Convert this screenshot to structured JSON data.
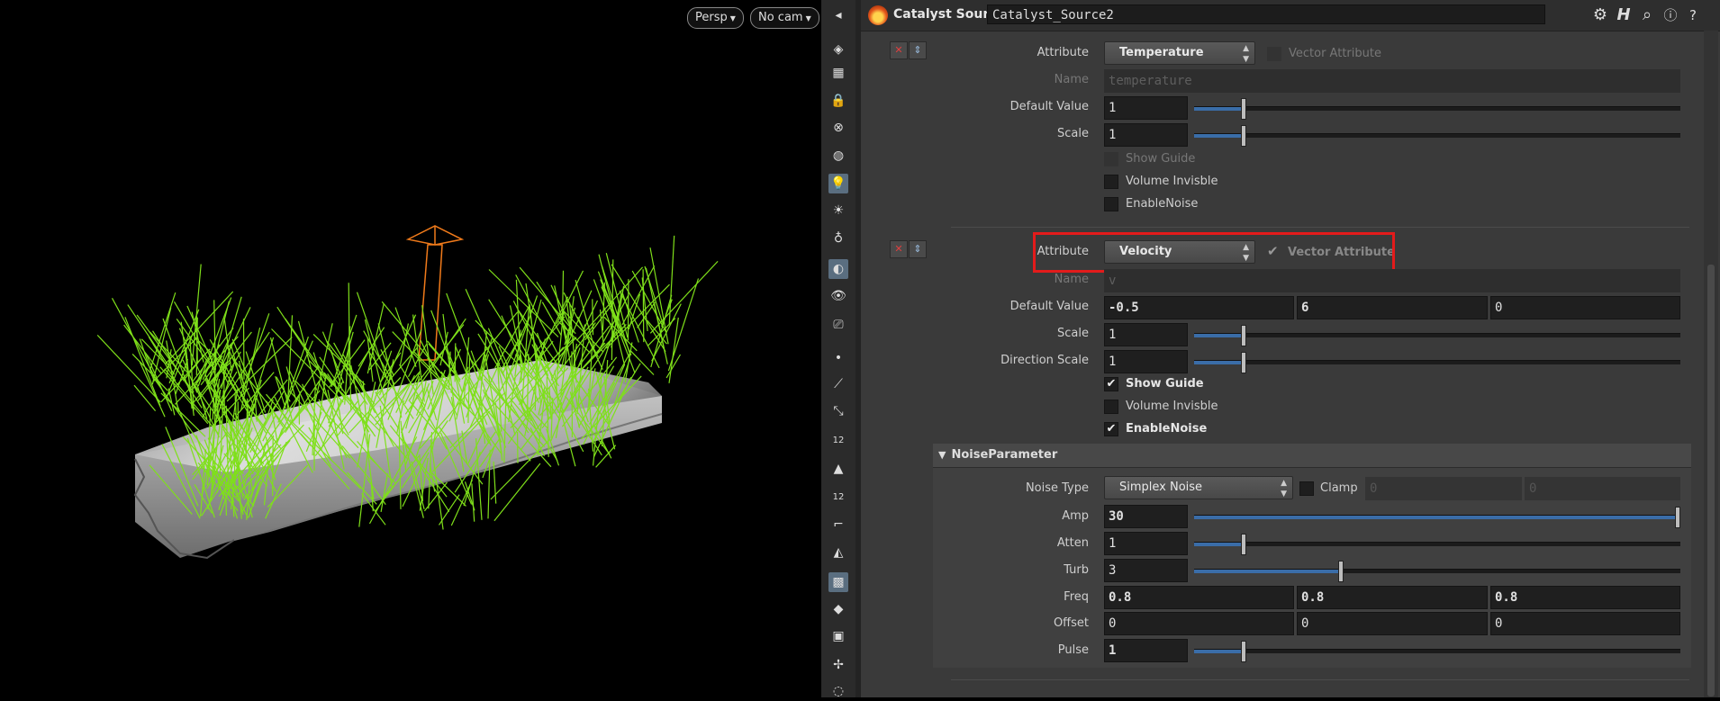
{
  "viewport": {
    "persp_label": "Persp",
    "cam_label": "No cam"
  },
  "header": {
    "node_type": "Catalyst Source",
    "node_name": "Catalyst_Source2",
    "icons": [
      "gear-icon",
      "houdini-h-icon",
      "search-icon",
      "info-icon",
      "help-icon"
    ]
  },
  "block1": {
    "attribute_label": "Attribute",
    "attribute_value": "Temperature",
    "vector_label": "Vector Attribute",
    "name_label": "Name",
    "name_value": "temperature",
    "default_label": "Default Value",
    "default_value": "1",
    "scale_label": "Scale",
    "scale_value": "1",
    "show_guide": "Show Guide",
    "volume_invisible": "Volume Invisble",
    "enable_noise": "EnableNoise"
  },
  "block2": {
    "attribute_label": "Attribute",
    "attribute_value": "Velocity",
    "vector_label": "Vector Attribute",
    "name_label": "Name",
    "name_value": "v",
    "default_label": "Default Value",
    "default_values": [
      "-0.5",
      "6",
      "0"
    ],
    "scale_label": "Scale",
    "scale_value": "1",
    "dir_scale_label": "Direction Scale",
    "dir_scale_value": "1",
    "show_guide": "Show Guide",
    "volume_invisible": "Volume Invisble",
    "enable_noise": "EnableNoise"
  },
  "noise": {
    "title": "NoiseParameter",
    "type_label": "Noise Type",
    "type_value": "Simplex Noise",
    "clamp_label": "Clamp",
    "clamp_values": [
      "0",
      "0"
    ],
    "amp_label": "Amp",
    "amp_value": "30",
    "atten_label": "Atten",
    "atten_value": "1",
    "turb_label": "Turb",
    "turb_value": "3",
    "freq_label": "Freq",
    "freq_values": [
      "0.8",
      "0.8",
      "0.8"
    ],
    "offset_label": "Offset",
    "offset_values": [
      "0",
      "0",
      "0"
    ],
    "pulse_label": "Pulse",
    "pulse_value": "1"
  },
  "toolbar_numbers": [
    "12",
    "12"
  ],
  "colors": {
    "highlight": "#e31b1b",
    "slider_fill": "#3a6da8",
    "voxel_gray": "#cfcfcf",
    "vector_green": "#7fe01a",
    "light_orange": "#f07a1a"
  }
}
